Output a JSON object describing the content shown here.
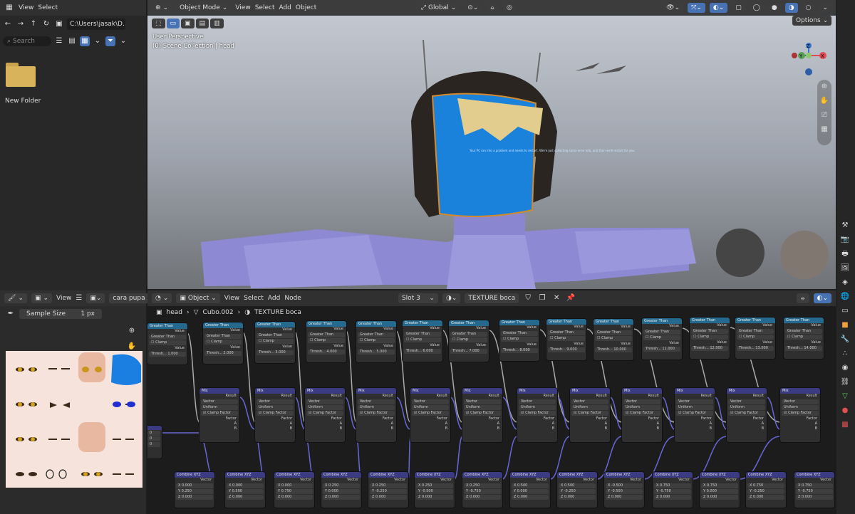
{
  "file_browser": {
    "menu": [
      "View",
      "Select"
    ],
    "path": "C:\\Users\\jasak\\D...",
    "search_placeholder": "Search",
    "folder_label": "New Folder"
  },
  "viewport": {
    "mode": "Object Mode",
    "menu": [
      "View",
      "Select",
      "Add",
      "Object"
    ],
    "transform": "Global",
    "perspective_label": "User Perspective",
    "collection_label": "(0) Scene Collection | head",
    "options": "Options",
    "gizmo_axes": [
      "X",
      "Y",
      "Z"
    ],
    "screen_text": "Your PC ran into a problem and needs to restart. We're just collecting some error info, and then we'll restart for you."
  },
  "image_editor": {
    "menu_view": "View",
    "image_name": "cara pupa",
    "sample_label": "Sample Size",
    "sample_value": "1 px"
  },
  "node_editor": {
    "type": "Object",
    "menu": [
      "View",
      "Select",
      "Add",
      "Node"
    ],
    "slot": "Slot 3",
    "material": "TEXTURE boca",
    "breadcrumb": [
      "head",
      "Cubo.002",
      "TEXTURE boca"
    ],
    "math_nodes": [
      {
        "title": "Greater Than",
        "thresh": "1.000"
      },
      {
        "title": "Greater Than",
        "thresh": "2.000"
      },
      {
        "title": "Greater Than",
        "thresh": "3.000"
      },
      {
        "title": "Greater Than",
        "thresh": "4.000"
      },
      {
        "title": "Greater Than",
        "thresh": "5.000"
      },
      {
        "title": "Greater Than",
        "thresh": "6.000"
      },
      {
        "title": "Greater Than",
        "thresh": "7.000"
      },
      {
        "title": "Greater Than",
        "thresh": "8.000"
      },
      {
        "title": "Greater Than",
        "thresh": "9.000"
      },
      {
        "title": "Greater Than",
        "thresh": "10.000"
      },
      {
        "title": "Greater Than",
        "thresh": "11.000"
      },
      {
        "title": "Greater Than",
        "thresh": "12.000"
      },
      {
        "title": "Greater Than",
        "thresh": "13.000"
      },
      {
        "title": "Greater Than",
        "thresh": "14.000"
      }
    ],
    "math_labels": {
      "value": "Value",
      "op": "Greater Than",
      "clamp": "Clamp",
      "thresh": "Thresh..."
    },
    "mix_labels": {
      "title": "Mix",
      "result": "Result",
      "type": "Vector",
      "mode": "Uniform",
      "clamp": "Clamp Factor",
      "factor": "Factor",
      "a": "A",
      "b": "B"
    },
    "combine_nodes": [
      {
        "x": "0.000",
        "y": "0.250",
        "z": "0.000"
      },
      {
        "x": "0.000",
        "y": "0.500",
        "z": "0.000"
      },
      {
        "x": "0.000",
        "y": "0.750",
        "z": "0.000"
      },
      {
        "x": "0.250",
        "y": "0.000",
        "z": "0.000"
      },
      {
        "x": "0.250",
        "y": "-0.250",
        "z": "0.000"
      },
      {
        "x": "0.250",
        "y": "-0.500",
        "z": "0.000"
      },
      {
        "x": "0.250",
        "y": "-0.750",
        "z": "0.000"
      },
      {
        "x": "0.500",
        "y": "0.000",
        "z": "0.000"
      },
      {
        "x": "0.500",
        "y": "-0.250",
        "z": "0.000"
      },
      {
        "x": "-0.500",
        "y": "-0.500",
        "z": "0.000"
      },
      {
        "x": "0.750",
        "y": "-0.750",
        "z": "0.000"
      },
      {
        "x": "0.750",
        "y": "0.000",
        "z": "0.000"
      },
      {
        "x": "0.750",
        "y": "-0.250",
        "z": "0.000"
      },
      {
        "x": "0.750",
        "y": "-0.750",
        "z": "0.000"
      }
    ],
    "combine_labels": {
      "title": "Combine XYZ",
      "out": "Vector",
      "x": "X",
      "y": "Y",
      "z": "Z"
    }
  }
}
